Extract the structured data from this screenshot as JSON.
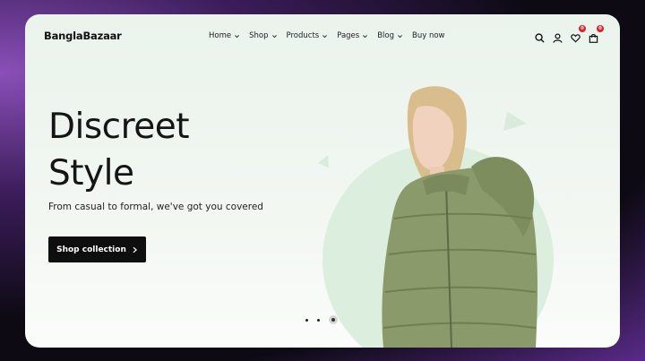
{
  "brand": "BanglaBazaar",
  "nav": [
    {
      "label": "Home",
      "dropdown": true
    },
    {
      "label": "Shop",
      "dropdown": true
    },
    {
      "label": "Products",
      "dropdown": true
    },
    {
      "label": "Pages",
      "dropdown": true
    },
    {
      "label": "Blog",
      "dropdown": true
    },
    {
      "label": "Buy now",
      "dropdown": false
    }
  ],
  "header_icons": {
    "search": "search-icon",
    "account": "user-icon",
    "wishlist": {
      "icon": "heart-icon",
      "count": "0"
    },
    "cart": {
      "icon": "bag-icon",
      "count": "0"
    }
  },
  "hero": {
    "headline_line1": "Discreet",
    "headline_line2": "Style",
    "subtitle": "From casual to formal, we've got you covered",
    "cta_label": "Shop collection"
  },
  "slider": {
    "count": 3,
    "active_index": 3
  },
  "colors": {
    "accent_circle": "#dcefdf",
    "badge": "#e0202a",
    "button": "#0e0e0e",
    "jacket": "#8a9a6a"
  }
}
